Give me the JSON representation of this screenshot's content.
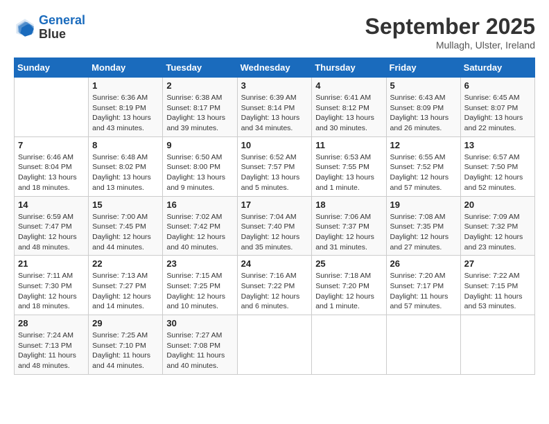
{
  "header": {
    "logo_line1": "General",
    "logo_line2": "Blue",
    "month": "September 2025",
    "location": "Mullagh, Ulster, Ireland"
  },
  "weekdays": [
    "Sunday",
    "Monday",
    "Tuesday",
    "Wednesday",
    "Thursday",
    "Friday",
    "Saturday"
  ],
  "weeks": [
    [
      {
        "num": "",
        "detail": ""
      },
      {
        "num": "1",
        "detail": "Sunrise: 6:36 AM\nSunset: 8:19 PM\nDaylight: 13 hours\nand 43 minutes."
      },
      {
        "num": "2",
        "detail": "Sunrise: 6:38 AM\nSunset: 8:17 PM\nDaylight: 13 hours\nand 39 minutes."
      },
      {
        "num": "3",
        "detail": "Sunrise: 6:39 AM\nSunset: 8:14 PM\nDaylight: 13 hours\nand 34 minutes."
      },
      {
        "num": "4",
        "detail": "Sunrise: 6:41 AM\nSunset: 8:12 PM\nDaylight: 13 hours\nand 30 minutes."
      },
      {
        "num": "5",
        "detail": "Sunrise: 6:43 AM\nSunset: 8:09 PM\nDaylight: 13 hours\nand 26 minutes."
      },
      {
        "num": "6",
        "detail": "Sunrise: 6:45 AM\nSunset: 8:07 PM\nDaylight: 13 hours\nand 22 minutes."
      }
    ],
    [
      {
        "num": "7",
        "detail": "Sunrise: 6:46 AM\nSunset: 8:04 PM\nDaylight: 13 hours\nand 18 minutes."
      },
      {
        "num": "8",
        "detail": "Sunrise: 6:48 AM\nSunset: 8:02 PM\nDaylight: 13 hours\nand 13 minutes."
      },
      {
        "num": "9",
        "detail": "Sunrise: 6:50 AM\nSunset: 8:00 PM\nDaylight: 13 hours\nand 9 minutes."
      },
      {
        "num": "10",
        "detail": "Sunrise: 6:52 AM\nSunset: 7:57 PM\nDaylight: 13 hours\nand 5 minutes."
      },
      {
        "num": "11",
        "detail": "Sunrise: 6:53 AM\nSunset: 7:55 PM\nDaylight: 13 hours\nand 1 minute."
      },
      {
        "num": "12",
        "detail": "Sunrise: 6:55 AM\nSunset: 7:52 PM\nDaylight: 12 hours\nand 57 minutes."
      },
      {
        "num": "13",
        "detail": "Sunrise: 6:57 AM\nSunset: 7:50 PM\nDaylight: 12 hours\nand 52 minutes."
      }
    ],
    [
      {
        "num": "14",
        "detail": "Sunrise: 6:59 AM\nSunset: 7:47 PM\nDaylight: 12 hours\nand 48 minutes."
      },
      {
        "num": "15",
        "detail": "Sunrise: 7:00 AM\nSunset: 7:45 PM\nDaylight: 12 hours\nand 44 minutes."
      },
      {
        "num": "16",
        "detail": "Sunrise: 7:02 AM\nSunset: 7:42 PM\nDaylight: 12 hours\nand 40 minutes."
      },
      {
        "num": "17",
        "detail": "Sunrise: 7:04 AM\nSunset: 7:40 PM\nDaylight: 12 hours\nand 35 minutes."
      },
      {
        "num": "18",
        "detail": "Sunrise: 7:06 AM\nSunset: 7:37 PM\nDaylight: 12 hours\nand 31 minutes."
      },
      {
        "num": "19",
        "detail": "Sunrise: 7:08 AM\nSunset: 7:35 PM\nDaylight: 12 hours\nand 27 minutes."
      },
      {
        "num": "20",
        "detail": "Sunrise: 7:09 AM\nSunset: 7:32 PM\nDaylight: 12 hours\nand 23 minutes."
      }
    ],
    [
      {
        "num": "21",
        "detail": "Sunrise: 7:11 AM\nSunset: 7:30 PM\nDaylight: 12 hours\nand 18 minutes."
      },
      {
        "num": "22",
        "detail": "Sunrise: 7:13 AM\nSunset: 7:27 PM\nDaylight: 12 hours\nand 14 minutes."
      },
      {
        "num": "23",
        "detail": "Sunrise: 7:15 AM\nSunset: 7:25 PM\nDaylight: 12 hours\nand 10 minutes."
      },
      {
        "num": "24",
        "detail": "Sunrise: 7:16 AM\nSunset: 7:22 PM\nDaylight: 12 hours\nand 6 minutes."
      },
      {
        "num": "25",
        "detail": "Sunrise: 7:18 AM\nSunset: 7:20 PM\nDaylight: 12 hours\nand 1 minute."
      },
      {
        "num": "26",
        "detail": "Sunrise: 7:20 AM\nSunset: 7:17 PM\nDaylight: 11 hours\nand 57 minutes."
      },
      {
        "num": "27",
        "detail": "Sunrise: 7:22 AM\nSunset: 7:15 PM\nDaylight: 11 hours\nand 53 minutes."
      }
    ],
    [
      {
        "num": "28",
        "detail": "Sunrise: 7:24 AM\nSunset: 7:13 PM\nDaylight: 11 hours\nand 48 minutes."
      },
      {
        "num": "29",
        "detail": "Sunrise: 7:25 AM\nSunset: 7:10 PM\nDaylight: 11 hours\nand 44 minutes."
      },
      {
        "num": "30",
        "detail": "Sunrise: 7:27 AM\nSunset: 7:08 PM\nDaylight: 11 hours\nand 40 minutes."
      },
      {
        "num": "",
        "detail": ""
      },
      {
        "num": "",
        "detail": ""
      },
      {
        "num": "",
        "detail": ""
      },
      {
        "num": "",
        "detail": ""
      }
    ]
  ]
}
